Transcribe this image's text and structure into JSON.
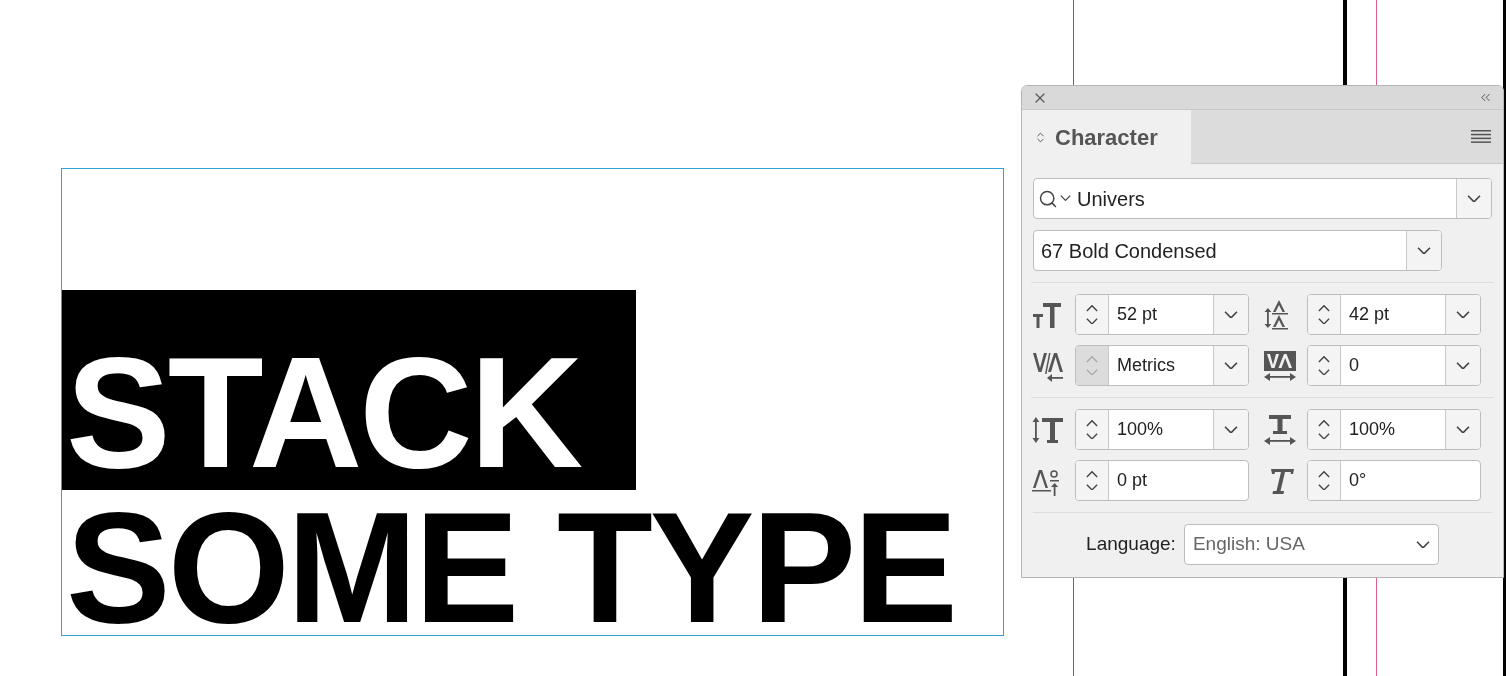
{
  "canvas": {
    "lines": [
      {
        "text": "STACK",
        "selected": true
      },
      {
        "text": "SOME TYPE",
        "selected": false
      }
    ]
  },
  "panel": {
    "tab": {
      "label": "Character",
      "selected": true
    },
    "font_family": {
      "value": "Univers"
    },
    "font_style": {
      "value": "67 Bold Condensed"
    },
    "groups": [
      [
        {
          "kind": "font-size",
          "value": "52 pt",
          "dropdown": true,
          "stepper_disabled": false
        },
        {
          "kind": "leading",
          "value": "42 pt",
          "dropdown": true,
          "stepper_disabled": false
        },
        {
          "kind": "kerning",
          "value": "Metrics",
          "dropdown": true,
          "stepper_disabled": true
        },
        {
          "kind": "tracking",
          "value": "0",
          "dropdown": true,
          "stepper_disabled": false
        }
      ],
      [
        {
          "kind": "vertical-scale",
          "value": "100%",
          "dropdown": true,
          "stepper_disabled": false
        },
        {
          "kind": "horizontal-scale",
          "value": "100%",
          "dropdown": true,
          "stepper_disabled": false
        },
        {
          "kind": "baseline-shift",
          "value": "0 pt",
          "dropdown": false,
          "stepper_disabled": false
        },
        {
          "kind": "skew",
          "value": "0°",
          "dropdown": false,
          "stepper_disabled": false
        }
      ]
    ],
    "language": {
      "label": "Language:",
      "value": "English: USA"
    }
  }
}
